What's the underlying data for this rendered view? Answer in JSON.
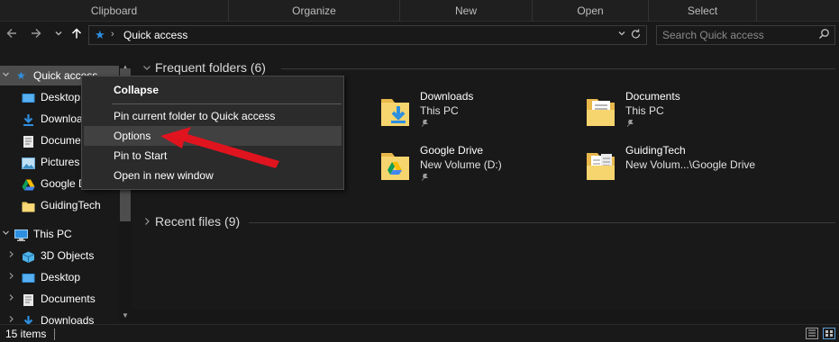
{
  "ribbon": {
    "groups": [
      "Clipboard",
      "Organize",
      "New",
      "Open",
      "Select"
    ]
  },
  "nav": {
    "back_icon": "back-arrow-icon",
    "forward_icon": "forward-arrow-icon",
    "recent_icon": "chevron-down-icon",
    "up_icon": "up-arrow-icon"
  },
  "address": {
    "path": "Quick access",
    "separator": "›"
  },
  "search": {
    "placeholder": "Search Quick access"
  },
  "sidebar": {
    "items": [
      {
        "label": "Quick access",
        "icon": "star-icon",
        "expanded": true,
        "selected": true
      },
      {
        "label": "Desktop",
        "icon": "desktop-icon"
      },
      {
        "label": "Downloads",
        "icon": "download-icon"
      },
      {
        "label": "Documents",
        "icon": "documents-icon"
      },
      {
        "label": "Pictures",
        "icon": "pictures-icon"
      },
      {
        "label": "Google Drive",
        "icon": "google-drive-icon"
      },
      {
        "label": "GuidingTech",
        "icon": "folder-icon"
      },
      {
        "label": "This PC",
        "icon": "computer-icon",
        "expanded": true
      },
      {
        "label": "3D Objects",
        "icon": "3d-objects-icon"
      },
      {
        "label": "Desktop",
        "icon": "desktop-icon"
      },
      {
        "label": "Documents",
        "icon": "documents-icon"
      },
      {
        "label": "Downloads",
        "icon": "download-icon"
      }
    ]
  },
  "content": {
    "frequent_header": "Frequent folders (6)",
    "recent_header": "Recent files (9)",
    "folders": [
      {
        "name": "Downloads",
        "location": "This PC",
        "icon": "downloads-folder-icon",
        "pinned": true
      },
      {
        "name": "Documents",
        "location": "This PC",
        "icon": "documents-folder-icon",
        "pinned": true
      },
      {
        "name": "Google Drive",
        "location": "New Volume (D:)",
        "icon": "google-drive-folder-icon",
        "pinned": true
      },
      {
        "name": "GuidingTech",
        "location": "New Volum...\\Google Drive",
        "icon": "folder-icon",
        "pinned": false
      }
    ]
  },
  "context_menu": {
    "items": [
      {
        "label": "Collapse",
        "bold": true
      },
      {
        "label": "Pin current folder to Quick access"
      },
      {
        "label": "Options",
        "hover": true
      },
      {
        "label": "Pin to Start"
      },
      {
        "label": "Open in new window"
      }
    ]
  },
  "status": {
    "item_count": "15 items"
  },
  "colors": {
    "accent": "#2e8fe0",
    "annotation_arrow": "#e0141e",
    "background": "#191919",
    "menu": "#2b2b2b"
  }
}
